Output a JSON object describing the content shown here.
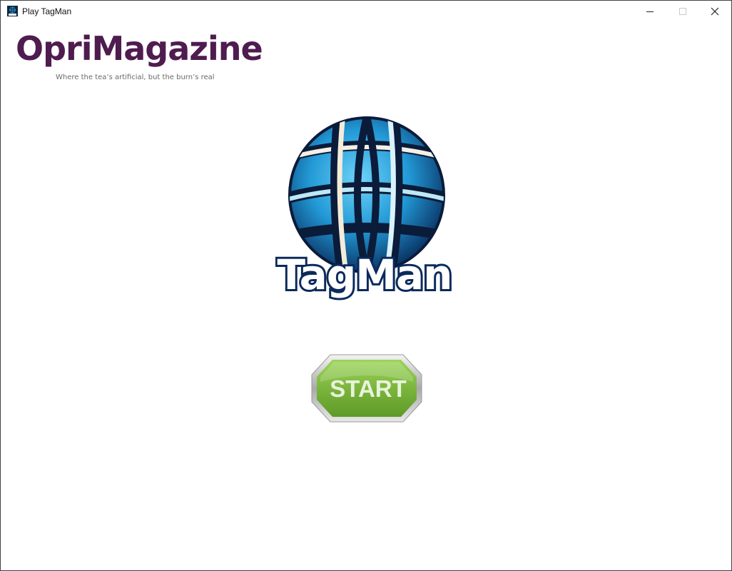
{
  "window": {
    "title": "Play TagMan",
    "icon": "tagman-app-icon"
  },
  "brand": {
    "name": "OpriMagazine",
    "tagline": "Where the tea’s artificial, but the burn’s real",
    "color": "#4f1c4f"
  },
  "logo": {
    "text": "TagMan",
    "icon": "globe-icon"
  },
  "start_button": {
    "label": "START",
    "color": "#7ab33a"
  }
}
